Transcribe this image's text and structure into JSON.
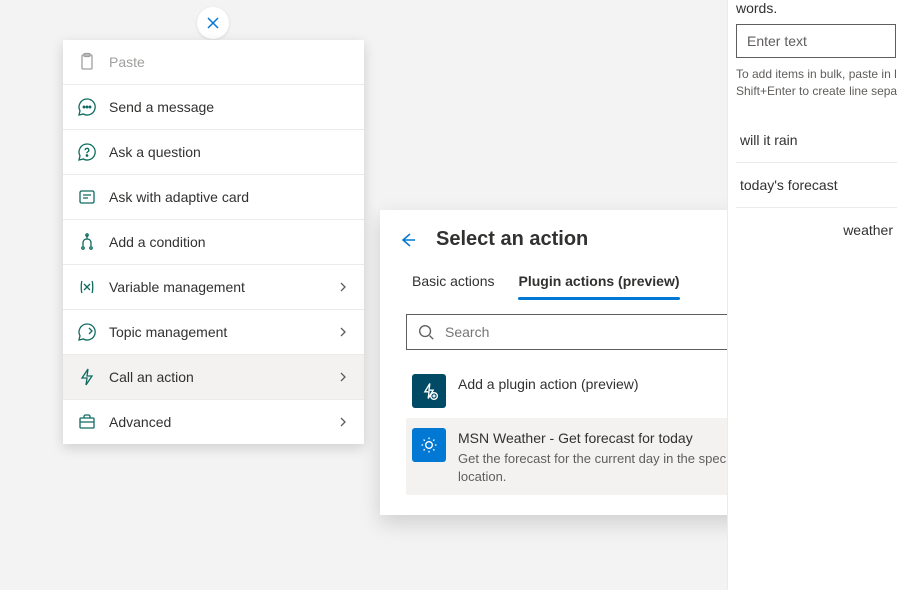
{
  "closeNode": {
    "name": "close-node"
  },
  "menu": {
    "items": [
      {
        "label": "Paste",
        "icon": "paste",
        "disabled": true,
        "hasChildren": false
      },
      {
        "label": "Send a message",
        "icon": "chat",
        "disabled": false,
        "hasChildren": false
      },
      {
        "label": "Ask a question",
        "icon": "question",
        "disabled": false,
        "hasChildren": false
      },
      {
        "label": "Ask with adaptive card",
        "icon": "card",
        "disabled": false,
        "hasChildren": false
      },
      {
        "label": "Add a condition",
        "icon": "branch",
        "disabled": false,
        "hasChildren": false
      },
      {
        "label": "Variable management",
        "icon": "variable",
        "disabled": false,
        "hasChildren": true
      },
      {
        "label": "Topic management",
        "icon": "topic",
        "disabled": false,
        "hasChildren": true
      },
      {
        "label": "Call an action",
        "icon": "lightning",
        "disabled": false,
        "hasChildren": true,
        "selected": true
      },
      {
        "label": "Advanced",
        "icon": "briefcase",
        "disabled": false,
        "hasChildren": true
      }
    ]
  },
  "panel": {
    "title": "Select an action",
    "tabs": [
      {
        "label": "Basic actions",
        "active": false
      },
      {
        "label": "Plugin actions (preview)",
        "active": true
      }
    ],
    "searchPlaceholder": "Search",
    "actions": [
      {
        "title": "Add a plugin action (preview)",
        "desc": "",
        "iconType": "dark"
      },
      {
        "title": "MSN Weather - Get forecast for today",
        "desc": "Get the forecast for the current day in the specified location.",
        "iconType": "sun",
        "highlight": true
      }
    ]
  },
  "side": {
    "wordsSuffix": "words.",
    "inputPlaceholder": "Enter text",
    "help1": "To add items in bulk, paste in li",
    "help2": "Shift+Enter to create line separ",
    "phrases": [
      "will it rain",
      "today's forecast",
      "weather"
    ]
  }
}
